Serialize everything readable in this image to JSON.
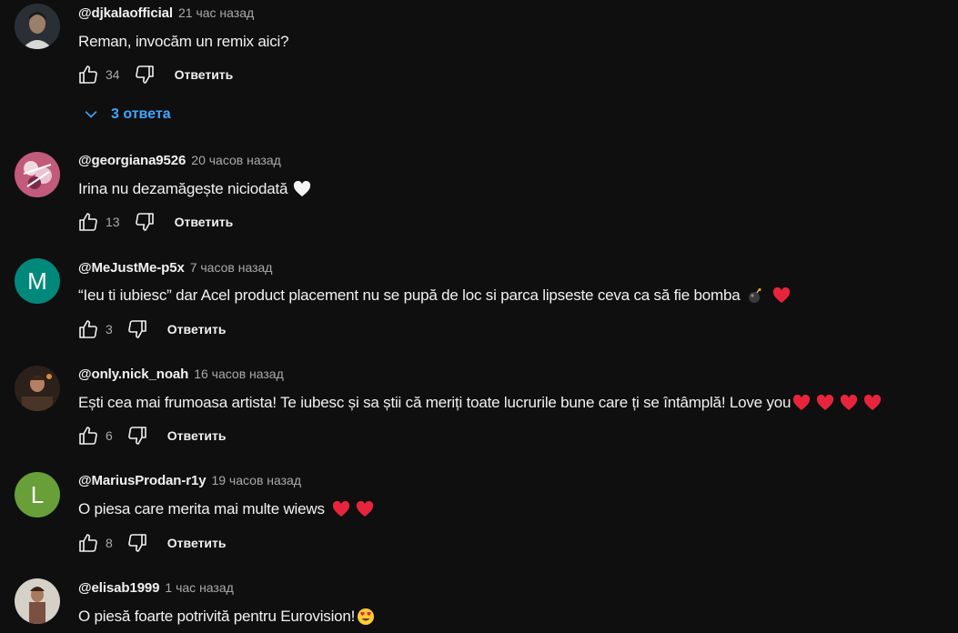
{
  "comments": [
    {
      "author": "@djkalaofficial",
      "time": "21 час назад",
      "text": "Reman, invocăm un remix aici?",
      "likes": "34",
      "reply_label": "Ответить",
      "avatar": {
        "kind": "photo",
        "colors": [
          "#2b2b2b",
          "#8a7a6a"
        ]
      },
      "replies_label": "3 ответа"
    },
    {
      "author": "@georgiana9526",
      "time": "20 часов назад",
      "text": "Irina nu dezamăgește niciodată",
      "emojis": [
        "white-heart"
      ],
      "likes": "13",
      "reply_label": "Ответить",
      "avatar": {
        "kind": "photo",
        "colors": [
          "#c7587a",
          "#e8b7c8"
        ]
      }
    },
    {
      "author": "@MeJustMe-p5x",
      "time": "7 часов назад",
      "text": "“Ieu ti iubiesc” dar Acel product placement nu se pupă de loc si parca lipseste ceva ca să fie bomba",
      "emojis": [
        "bomb",
        "red-heart"
      ],
      "likes": "3",
      "reply_label": "Ответить",
      "avatar": {
        "kind": "letter",
        "letter": "M",
        "color": "#00897b"
      }
    },
    {
      "author": "@only.nick_noah",
      "time": "16 часов назад",
      "text": "Ești cea mai frumoasa artista! Te iubesc și sa știi că meriți toate lucrurile bune care ți se întâmplă! Love you",
      "emojis": [
        "red-heart",
        "red-heart",
        "red-heart",
        "red-heart"
      ],
      "likes": "6",
      "reply_label": "Ответить",
      "avatar": {
        "kind": "photo",
        "colors": [
          "#3a2a22",
          "#b07a5a"
        ]
      }
    },
    {
      "author": "@MariusProdan-r1y",
      "time": "19 часов назад",
      "text": "O  piesa care merita mai multe wiews",
      "emojis": [
        "red-heart",
        "red-heart"
      ],
      "likes": "8",
      "reply_label": "Ответить",
      "avatar": {
        "kind": "letter",
        "letter": "L",
        "color": "#689f38"
      }
    },
    {
      "author": "@elisab1999",
      "time": "1 час назад",
      "text": "O piesă foarte potrivită pentru Eurovision!",
      "emojis": [
        "heart-eyes"
      ],
      "avatar": {
        "kind": "photo",
        "colors": [
          "#d9d4cc",
          "#6a4a3a"
        ]
      }
    }
  ],
  "colors": {
    "background": "#0f0f0f",
    "text": "#f1f1f1",
    "secondary_text": "#aaaaaa",
    "link": "#3ea6ff"
  }
}
